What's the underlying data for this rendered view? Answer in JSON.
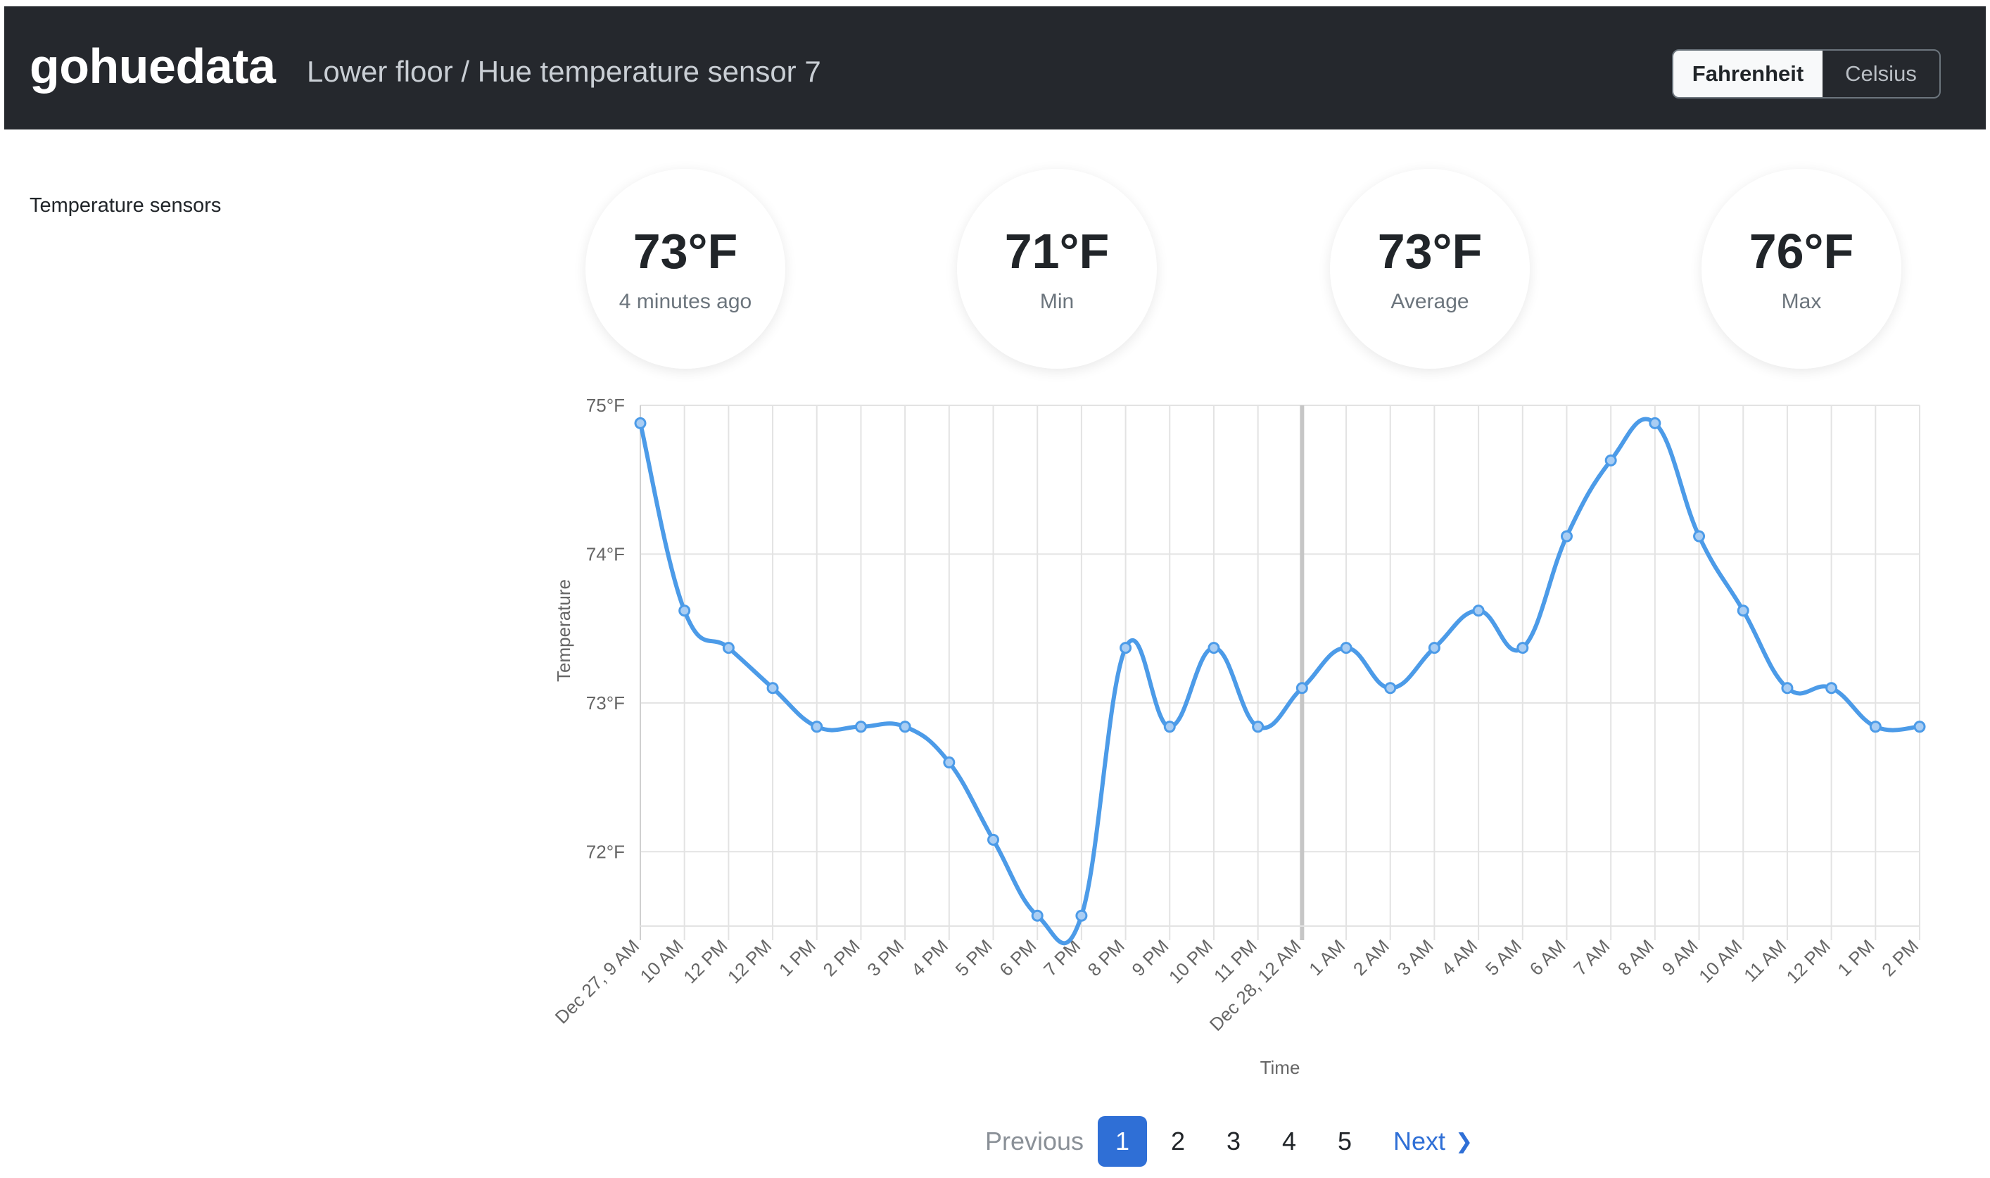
{
  "header": {
    "brand": "gohuedata",
    "breadcrumb": "Lower floor / Hue temperature sensor 7",
    "units": {
      "fahrenheit": "Fahrenheit",
      "celsius": "Celsius",
      "selected": "Fahrenheit"
    }
  },
  "sidebar": {
    "title": "Temperature sensors"
  },
  "stats": [
    {
      "value": "73°F",
      "label": "4 minutes ago"
    },
    {
      "value": "71°F",
      "label": "Min"
    },
    {
      "value": "73°F",
      "label": "Average"
    },
    {
      "value": "76°F",
      "label": "Max"
    }
  ],
  "chart_data": {
    "type": "line",
    "xlabel": "Time",
    "ylabel": "Temperature",
    "ylim": [
      71.5,
      75.0
    ],
    "yticks": [
      "75°F",
      "74°F",
      "73°F",
      "72°F"
    ],
    "ytick_values": [
      75,
      74,
      73,
      72
    ],
    "grid": true,
    "x": [
      "Dec 27, 9 AM",
      "10 AM",
      "12 PM",
      "12 PM",
      "1 PM",
      "2 PM",
      "3 PM",
      "4 PM",
      "5 PM",
      "6 PM",
      "7 PM",
      "8 PM",
      "9 PM",
      "10 PM",
      "11 PM",
      "Dec 28, 12 AM",
      "1 AM",
      "2 AM",
      "3 AM",
      "4 AM",
      "5 AM",
      "6 AM",
      "7 AM",
      "8 AM",
      "9 AM",
      "10 AM",
      "11 AM",
      "12 PM",
      "1 PM",
      "2 PM"
    ],
    "series": [
      {
        "values": [
          74.88,
          73.62,
          73.37,
          73.1,
          72.84,
          72.84,
          72.84,
          72.6,
          72.08,
          71.57,
          71.57,
          73.37,
          72.84,
          73.37,
          72.84,
          73.1,
          73.37,
          73.1,
          73.37,
          73.62,
          73.37,
          74.12,
          74.63,
          74.88,
          74.12,
          73.62,
          73.1,
          73.1,
          72.84,
          72.84
        ],
        "color": "#4c9be8"
      }
    ],
    "highlight_x": "Dec 28, 12 AM"
  },
  "pagination": {
    "previous": "Previous",
    "pages": [
      "1",
      "2",
      "3",
      "4",
      "5"
    ],
    "active": "1",
    "next": "Next",
    "next_icon": "chevron-right-icon"
  }
}
